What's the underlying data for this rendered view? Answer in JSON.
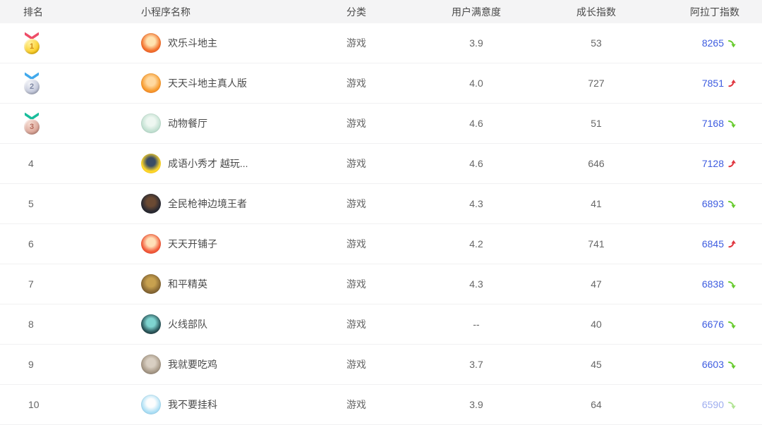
{
  "table": {
    "headers": {
      "rank": "排名",
      "name": "小程序名称",
      "category": "分类",
      "satisfaction": "用户满意度",
      "growth": "成长指数",
      "aladdin": "阿拉丁指数"
    },
    "rows": [
      {
        "rank": "1",
        "medal": "gold",
        "name": "欢乐斗地主",
        "category": "游戏",
        "satisfaction": "3.9",
        "growth": "53",
        "aladdin": "8265",
        "trend": "down",
        "avatar_colors": [
          "#ffe3b0",
          "#f3722c",
          "#e84b31"
        ]
      },
      {
        "rank": "2",
        "medal": "silver",
        "name": "天天斗地主真人版",
        "category": "游戏",
        "satisfaction": "4.0",
        "growth": "727",
        "aladdin": "7851",
        "trend": "up",
        "avatar_colors": [
          "#ffd9a0",
          "#f79b2e",
          "#ef6a1f"
        ]
      },
      {
        "rank": "3",
        "medal": "bronze",
        "name": "动物餐厅",
        "category": "游戏",
        "satisfaction": "4.6",
        "growth": "51",
        "aladdin": "7168",
        "trend": "down",
        "avatar_colors": [
          "#eef7f1",
          "#c3e1d2",
          "#9fc9b9"
        ]
      },
      {
        "rank": "4",
        "name": "成语小秀才 越玩...",
        "category": "游戏",
        "satisfaction": "4.6",
        "growth": "646",
        "aladdin": "7128",
        "trend": "up",
        "avatar_colors": [
          "#3a4c66",
          "#ffd829",
          "#fcc51d"
        ]
      },
      {
        "rank": "5",
        "name": "全民枪神边境王者",
        "category": "游戏",
        "satisfaction": "4.3",
        "growth": "41",
        "aladdin": "6893",
        "trend": "down",
        "avatar_colors": [
          "#6b4a33",
          "#2b2b33",
          "#17171d"
        ]
      },
      {
        "rank": "6",
        "name": "天天开铺子",
        "category": "游戏",
        "satisfaction": "4.2",
        "growth": "741",
        "aladdin": "6845",
        "trend": "up",
        "avatar_colors": [
          "#ffe0b8",
          "#f25c3a",
          "#e23c2e"
        ]
      },
      {
        "rank": "7",
        "name": "和平精英",
        "category": "游戏",
        "satisfaction": "4.3",
        "growth": "47",
        "aladdin": "6838",
        "trend": "down",
        "avatar_colors": [
          "#c8a14f",
          "#8a6a35",
          "#5f4a26"
        ]
      },
      {
        "rank": "8",
        "name": "火线部队",
        "category": "游戏",
        "satisfaction": "--",
        "growth": "40",
        "aladdin": "6676",
        "trend": "down",
        "avatar_colors": [
          "#7fd4d0",
          "#2d5a5e",
          "#101418"
        ]
      },
      {
        "rank": "9",
        "name": "我就要吃鸡",
        "category": "游戏",
        "satisfaction": "3.7",
        "growth": "45",
        "aladdin": "6603",
        "trend": "down",
        "avatar_colors": [
          "#d9cfc2",
          "#a89a88",
          "#6f665c"
        ]
      },
      {
        "rank": "10",
        "name": "我不要挂科",
        "category": "游戏",
        "satisfaction": "3.9",
        "growth": "64",
        "aladdin": "6590",
        "trend": "down",
        "muted": true,
        "avatar_colors": [
          "#fdfdfd",
          "#aee0f5",
          "#7ec3ea"
        ]
      }
    ]
  },
  "colors": {
    "header_bg": "#f4f4f5",
    "index_value": "#3d5ce0",
    "trend_up": "#e0363f",
    "trend_down": "#67cb2d",
    "medals": {
      "gold": {
        "ribbon": "#ee4d68",
        "coin_light": "#fff3a0",
        "coin": "#fbc918",
        "number": "#d08a16"
      },
      "silver": {
        "ribbon": "#41a9ec",
        "coin_light": "#f4f5f9",
        "coin": "#b9bfd4",
        "number": "#7e87a3"
      },
      "bronze": {
        "ribbon": "#19bd9c",
        "coin_light": "#f6ded4",
        "coin": "#d79c8e",
        "number": "#b3685a"
      }
    }
  }
}
